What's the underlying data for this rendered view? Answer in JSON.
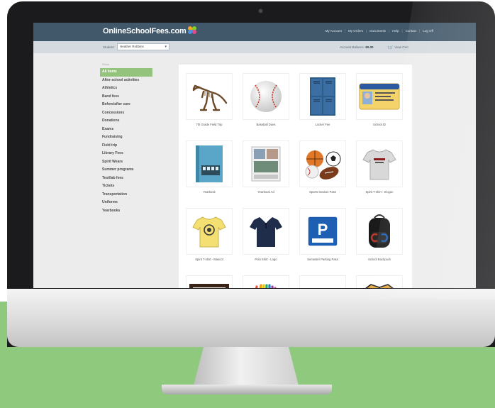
{
  "brand": {
    "logo_text": "OnlineSchoolFees.com"
  },
  "topnav": {
    "items": [
      "My Account",
      "My Orders",
      "Documents",
      "Help",
      "Contact",
      "Log Off"
    ]
  },
  "subbar": {
    "student_label": "Student:",
    "student_value": "Heather Robbins",
    "account_balance_label": "Account Balance:",
    "account_balance_value": "$0.00",
    "cart_label": "View Cart"
  },
  "sidebar": {
    "title": "Show",
    "items": [
      {
        "label": "All items",
        "active": true
      },
      {
        "label": "After-school activities"
      },
      {
        "label": "Athletics"
      },
      {
        "label": "Band fees"
      },
      {
        "label": "Before/after care"
      },
      {
        "label": "Concessions"
      },
      {
        "label": "Donations"
      },
      {
        "label": "Exams"
      },
      {
        "label": "Fundraising"
      },
      {
        "label": "Field trip"
      },
      {
        "label": "Library Fees"
      },
      {
        "label": "Spirit Wears"
      },
      {
        "label": "Summer programs"
      },
      {
        "label": "Test/lab fees"
      },
      {
        "label": "Tickets"
      },
      {
        "label": "Transportation"
      },
      {
        "label": "Uniforms"
      },
      {
        "label": "Yearbooks"
      }
    ]
  },
  "products": [
    {
      "label": "7th Grade Field Trip",
      "icon": "dinosaur-icon"
    },
    {
      "label": "Baseball Dues",
      "icon": "baseball-icon"
    },
    {
      "label": "Locker Fee",
      "icon": "locker-icon"
    },
    {
      "label": "School ID",
      "icon": "id-card-icon"
    },
    {
      "label": "Yearbook",
      "icon": "yearbook-icon"
    },
    {
      "label": "Yearbook Ad",
      "icon": "yearbook-ad-icon"
    },
    {
      "label": "Sports Season Pass",
      "icon": "sports-balls-icon"
    },
    {
      "label": "Spirit T-shirt - Slogan",
      "icon": "tshirt-gray-icon"
    },
    {
      "label": "Spirit T-shirt - Mascot",
      "icon": "tshirt-yellow-icon"
    },
    {
      "label": "Polo Shirt - Logo",
      "icon": "polo-shirt-icon"
    },
    {
      "label": "Semester Parking Pass",
      "icon": "parking-sign-icon"
    },
    {
      "label": "School Backpack",
      "icon": "backpack-icon"
    },
    {
      "label": "",
      "icon": "diploma-frame-icon"
    },
    {
      "label": "",
      "icon": "colored-pencils-icon"
    },
    {
      "label": "",
      "icon": "trumpet-icon"
    },
    {
      "label": "",
      "icon": "tiger-mascot-icon"
    }
  ],
  "colors": {
    "topbar": "#41586a",
    "subbar": "#d4dadf",
    "active_item": "#93c37d",
    "background_band": "#8fc97e"
  }
}
